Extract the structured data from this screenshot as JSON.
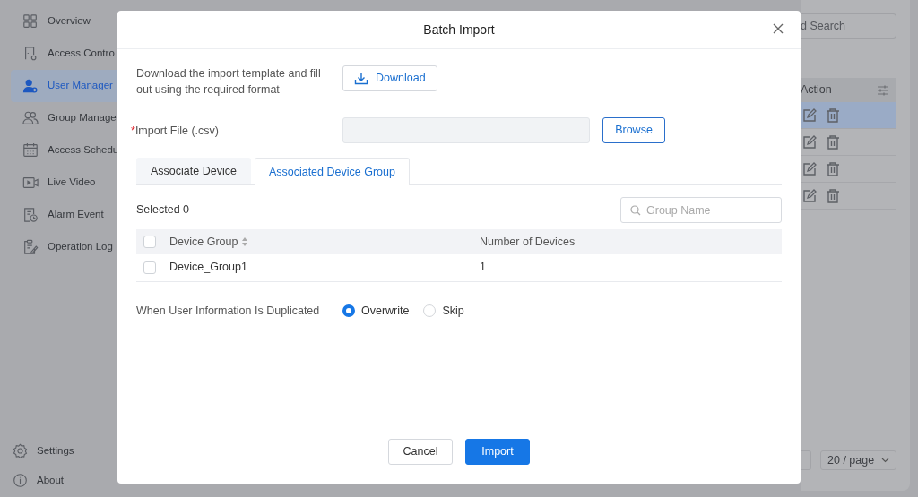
{
  "sidebar": {
    "items": [
      {
        "label": "Overview",
        "selected": false
      },
      {
        "label": "Access Contro",
        "selected": false
      },
      {
        "label": "User Manager",
        "selected": true
      },
      {
        "label": "Group Manage",
        "selected": false
      },
      {
        "label": "Access Schedu",
        "selected": false
      },
      {
        "label": "Live Video",
        "selected": false
      },
      {
        "label": "Alarm Event",
        "selected": false
      },
      {
        "label": "Operation Log",
        "selected": false
      }
    ],
    "footer_items": [
      {
        "label": "Settings"
      },
      {
        "label": "About"
      }
    ]
  },
  "background": {
    "search": {
      "placeholder": "d Search"
    },
    "table": {
      "columns": [
        "Action"
      ],
      "rows": [
        {
          "selected": true
        },
        {
          "selected": false
        },
        {
          "selected": false
        },
        {
          "selected": false
        }
      ]
    },
    "pagination": {
      "page_size": "20 / page"
    }
  },
  "dialog": {
    "title": "Batch Import",
    "template_hint": "Download the import template and fill out using the required format",
    "download_button": "Download",
    "import_file": {
      "required_mark": "*",
      "label": "Import File (.csv)",
      "browse_button": "Browse"
    },
    "tabs": [
      {
        "label": "Associate Device",
        "selected": false
      },
      {
        "label": "Associated Device Group",
        "selected": true
      }
    ],
    "selected_count": "Selected 0",
    "search": {
      "placeholder": "Group Name"
    },
    "table": {
      "header_checked": false,
      "columns": [
        "Device Group",
        "Number of Devices"
      ],
      "rows": [
        {
          "checked": false,
          "cells": [
            "Device_Group1",
            "1"
          ]
        }
      ]
    },
    "duplicate": {
      "label": "When User Information Is Duplicated",
      "options": [
        {
          "label": "Overwrite",
          "selected": true
        },
        {
          "label": "Skip",
          "selected": false
        }
      ]
    },
    "buttons": [
      {
        "label": "Cancel",
        "kind": "secondary"
      },
      {
        "label": "Import",
        "kind": "primary"
      }
    ]
  }
}
